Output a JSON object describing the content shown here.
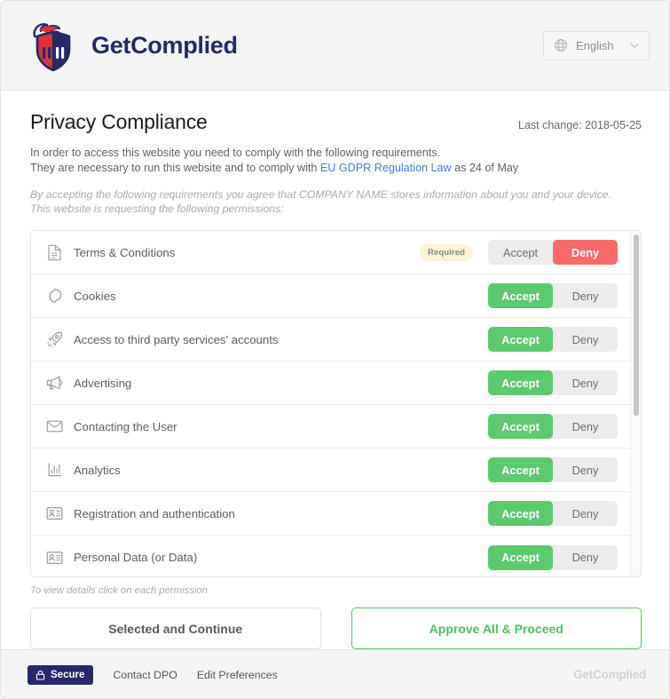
{
  "header": {
    "brand_name": "GetComplied",
    "logo_icon": "shield-flame-logo",
    "language": {
      "icon": "globe-icon",
      "selected": "English",
      "caret_icon": "chevron-down-icon"
    }
  },
  "main": {
    "page_title": "Privacy Compliance",
    "last_change": "Last change: 2018-05-25",
    "intro_line1": "In order to access this website you need to comply with the following requirements.",
    "intro_line2_pre": "They are necessary to run this website and to comply with ",
    "intro_line2_link": "EU GDPR Regulation Law",
    "intro_line2_post": " as 24 of May",
    "sub_intro_line1": "By accepting the following requirements you agree that COMPANY NAME stores information about you and your device.",
    "sub_intro_line2": "This website is requesting the following permissions:",
    "hint": "To view details click on each permission",
    "accept_label": "Accept",
    "deny_label": "Deny",
    "required_badge": "Required",
    "permissions": [
      {
        "label": "Terms & Conditions",
        "icon": "document-icon",
        "required": true,
        "required_label": "Required",
        "state": "deny",
        "accept": "Accept",
        "deny": "Deny"
      },
      {
        "label": "Cookies",
        "icon": "cookie-icon",
        "required": false,
        "required_label": "",
        "state": "accept",
        "accept": "Accept",
        "deny": "Deny"
      },
      {
        "label": "Access to third party services' accounts",
        "icon": "rocket-icon",
        "required": false,
        "required_label": "",
        "state": "accept",
        "accept": "Accept",
        "deny": "Deny"
      },
      {
        "label": "Advertising",
        "icon": "megaphone-icon",
        "required": false,
        "required_label": "",
        "state": "accept",
        "accept": "Accept",
        "deny": "Deny"
      },
      {
        "label": "Contacting the User",
        "icon": "envelope-icon",
        "required": false,
        "required_label": "",
        "state": "accept",
        "accept": "Accept",
        "deny": "Deny"
      },
      {
        "label": "Analytics",
        "icon": "bar-chart-icon",
        "required": false,
        "required_label": "",
        "state": "accept",
        "accept": "Accept",
        "deny": "Deny"
      },
      {
        "label": "Registration and authentication",
        "icon": "id-card-icon",
        "required": false,
        "required_label": "",
        "state": "accept",
        "accept": "Accept",
        "deny": "Deny"
      },
      {
        "label": "Personal Data (or Data)",
        "icon": "id-card-icon",
        "required": false,
        "required_label": "",
        "state": "accept",
        "accept": "Accept",
        "deny": "Deny"
      }
    ],
    "buttons": {
      "secondary": "Selected and Continue",
      "primary": "Approve All & Proceed"
    }
  },
  "footer": {
    "secure_badge": "Secure",
    "secure_icon": "lock-icon",
    "links": [
      {
        "label": "Contact DPO"
      },
      {
        "label": "Edit Preferences"
      }
    ],
    "watermark": "GetComplied"
  },
  "colors": {
    "accept_green": "#5dc96f",
    "deny_red": "#f76b6b",
    "brand_navy": "#242a66",
    "brand_red": "#e0313b",
    "link_blue": "#3d7de0",
    "required_badge_bg": "#fcf3d4",
    "header_bg": "#f5f5f7"
  }
}
